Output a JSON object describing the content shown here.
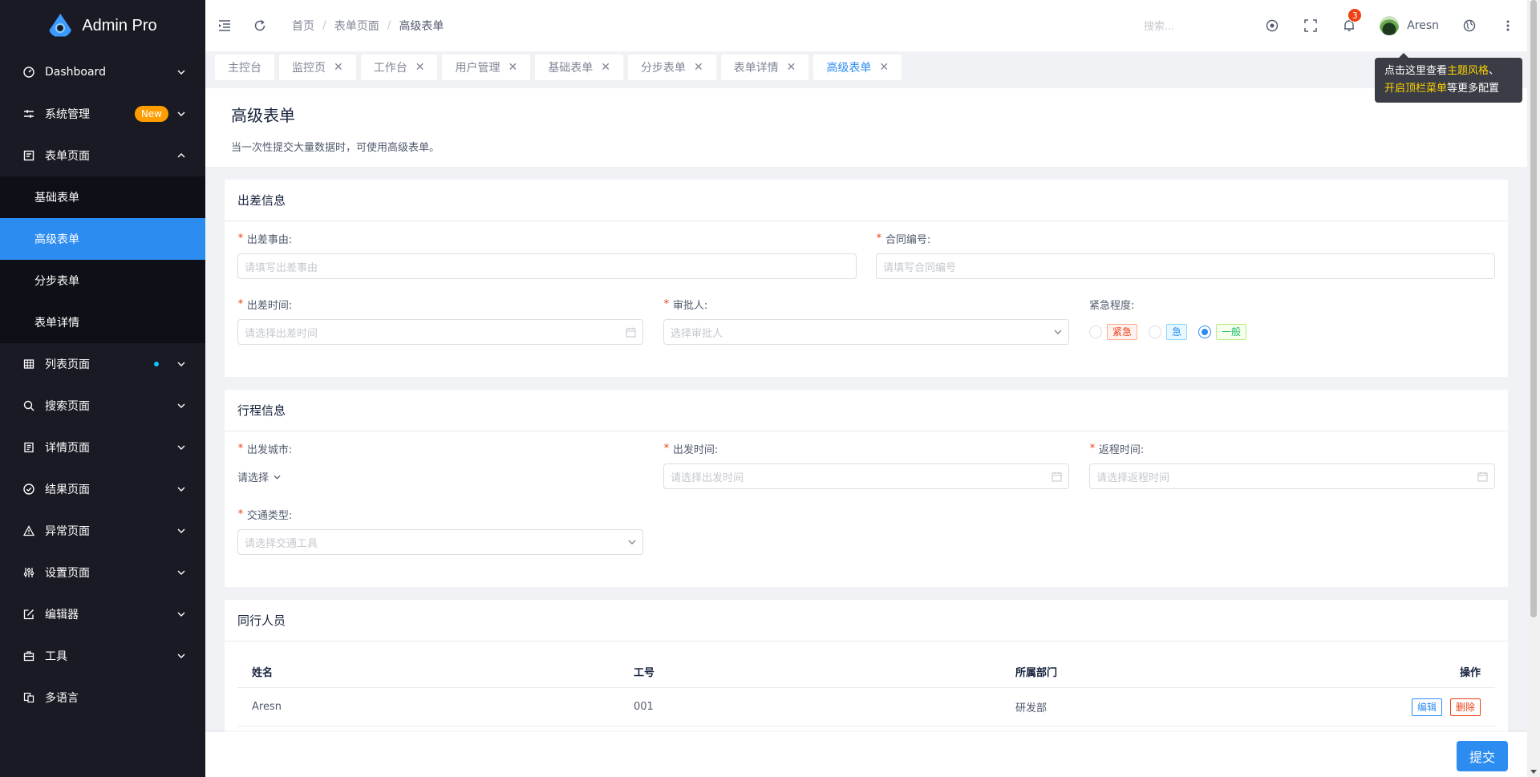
{
  "app": {
    "title": "Admin Pro"
  },
  "sidebar": {
    "items": [
      {
        "label": "Dashboard",
        "icon": "dashboard-icon"
      },
      {
        "label": "系统管理",
        "icon": "sliders-icon",
        "badge": "New"
      },
      {
        "label": "表单页面",
        "icon": "form-icon",
        "expanded": true,
        "children": [
          {
            "label": "基础表单"
          },
          {
            "label": "高级表单",
            "active": true
          },
          {
            "label": "分步表单"
          },
          {
            "label": "表单详情"
          }
        ]
      },
      {
        "label": "列表页面",
        "icon": "table-icon",
        "dot": true
      },
      {
        "label": "搜索页面",
        "icon": "search-icon"
      },
      {
        "label": "详情页面",
        "icon": "detail-icon"
      },
      {
        "label": "结果页面",
        "icon": "check-circle-icon"
      },
      {
        "label": "异常页面",
        "icon": "warning-icon"
      },
      {
        "label": "设置页面",
        "icon": "settings-icon"
      },
      {
        "label": "编辑器",
        "icon": "edit-icon"
      },
      {
        "label": "工具",
        "icon": "toolbox-icon"
      },
      {
        "label": "多语言",
        "icon": "translate-icon"
      }
    ]
  },
  "header": {
    "breadcrumb": [
      "首页",
      "表单页面",
      "高级表单"
    ],
    "search_placeholder": "搜索...",
    "notification_count": "3",
    "username": "Aresn"
  },
  "tabs": [
    {
      "label": "主控台",
      "closable": false
    },
    {
      "label": "监控页",
      "closable": true
    },
    {
      "label": "工作台",
      "closable": true
    },
    {
      "label": "用户管理",
      "closable": true
    },
    {
      "label": "基础表单",
      "closable": true
    },
    {
      "label": "分步表单",
      "closable": true
    },
    {
      "label": "表单详情",
      "closable": true
    },
    {
      "label": "高级表单",
      "closable": true,
      "active": true
    }
  ],
  "tooltip": {
    "line1_a": "点击这里查看",
    "line1_hl": "主题风格",
    "line1_b": "、",
    "line2_hl": "开启顶栏菜单",
    "line2_b": "等更多配置"
  },
  "page": {
    "title": "高级表单",
    "description": "当一次性提交大量数据时，可使用高级表单。"
  },
  "trip": {
    "title": "出差信息",
    "reason_label": "出差事由:",
    "reason_placeholder": "请填写出差事由",
    "contract_label": "合同编号:",
    "contract_placeholder": "请填写合同编号",
    "time_label": "出差时间:",
    "time_placeholder": "请选择出差时间",
    "approver_label": "审批人:",
    "approver_placeholder": "选择审批人",
    "urgency_label": "紧急程度:",
    "urgency_options": [
      "紧急",
      "急",
      "一般"
    ],
    "urgency_selected": "一般"
  },
  "itinerary": {
    "title": "行程信息",
    "city_label": "出发城市:",
    "city_value": "请选择",
    "depart_label": "出发时间:",
    "depart_placeholder": "请选择出发时间",
    "return_label": "返程时间:",
    "return_placeholder": "请选择返程时间",
    "transport_label": "交通类型:",
    "transport_placeholder": "请选择交通工具"
  },
  "companions": {
    "title": "同行人员",
    "columns": [
      "姓名",
      "工号",
      "所属部门",
      "操作"
    ],
    "rows": [
      {
        "name": "Aresn",
        "id": "001",
        "dept": "研发部",
        "edit": "编辑",
        "delete": "删除"
      }
    ]
  },
  "footer": {
    "submit": "提交"
  },
  "colors": {
    "primary": "#2d8cf0",
    "sidebar_bg": "#191a23",
    "danger": "#ed4014",
    "warning": "#ff9d00"
  }
}
